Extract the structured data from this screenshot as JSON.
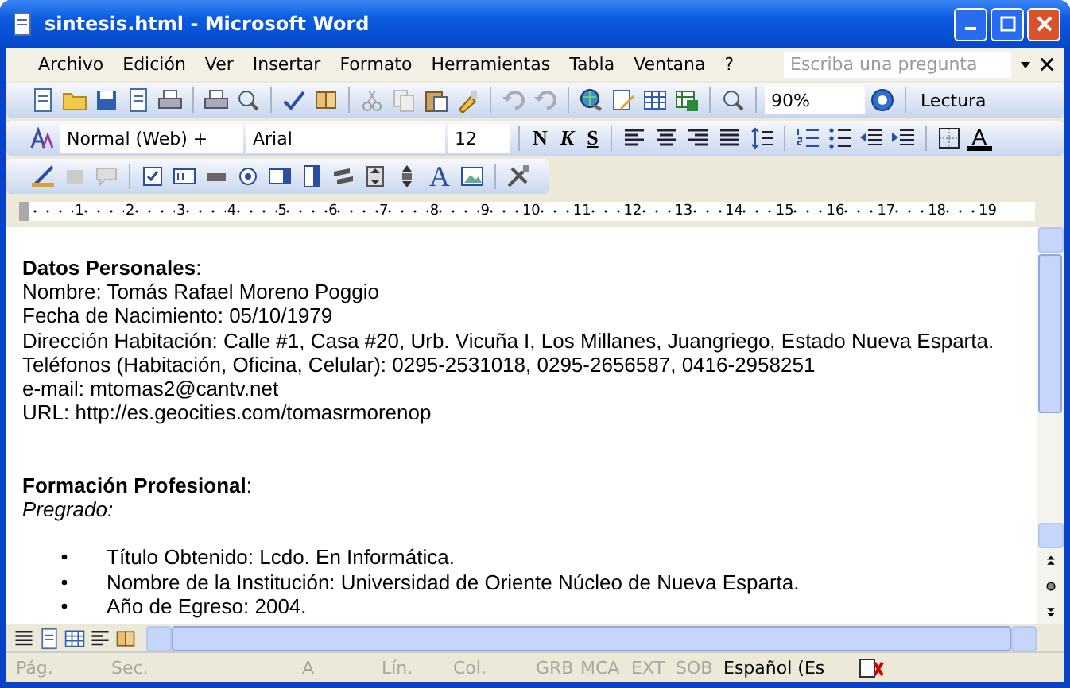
{
  "window": {
    "title": "sintesis.html - Microsoft Word"
  },
  "menu": {
    "items": [
      "Archivo",
      "Edición",
      "Ver",
      "Insertar",
      "Formato",
      "Herramientas",
      "Tabla",
      "Ventana",
      "?"
    ],
    "help_box": {
      "placeholder": "Escriba una pregunta"
    }
  },
  "standard_toolbar": {
    "zoom": "90%",
    "reading_button": "Lectura"
  },
  "format_toolbar": {
    "style": "Normal (Web) +",
    "font": "Arial",
    "size": "12",
    "bold": "N",
    "italic": "K",
    "underline": "S",
    "font_color": "A"
  },
  "forms_toolbar": {
    "wordart": "A"
  },
  "ruler": [
    "1",
    "2",
    "3",
    "4",
    "5",
    "6",
    "7",
    "8",
    "9",
    "10",
    "11",
    "12",
    "13",
    "14",
    "15",
    "16",
    "17",
    "18",
    "19"
  ],
  "document": [
    {
      "kind": "line",
      "text": "**Datos Personales**:"
    },
    {
      "kind": "line",
      "text": "Nombre: Tomás Rafael Moreno Poggio"
    },
    {
      "kind": "line",
      "text": "Fecha de Nacimiento: 05/10/1979"
    },
    {
      "kind": "line",
      "text": "Dirección Habitación: Calle #1, Casa #20, Urb. Vicuña I, Los Millanes, Juangriego, Estado Nueva Esparta."
    },
    {
      "kind": "line",
      "text": "Teléfonos (Habitación, Oficina, Celular): 0295-2531018, 0295-2656587, 0416-2958251"
    },
    {
      "kind": "line",
      "text": "e-mail: mtomas2@cantv.net"
    },
    {
      "kind": "line",
      "text": "URL: http://es.geocities.com/tomasrmorenop"
    },
    {
      "kind": "blank"
    },
    {
      "kind": "blank"
    },
    {
      "kind": "line",
      "text": "**Formación Profesional**:"
    },
    {
      "kind": "italic",
      "text": "Pregrado:"
    },
    {
      "kind": "blank"
    },
    {
      "kind": "bullet",
      "text": "Título Obtenido: Lcdo. En Informática."
    },
    {
      "kind": "bullet",
      "text": "Nombre de la Institución: Universidad de Oriente Núcleo de Nueva Esparta."
    },
    {
      "kind": "bullet",
      "text": "Año de Egreso: 2004."
    }
  ],
  "status_bar": [
    {
      "label": "Pág.",
      "disabled": true
    },
    {
      "label": "Sec.",
      "disabled": true
    },
    {
      "label": "A",
      "disabled": true
    },
    {
      "label": "Lín.",
      "disabled": true
    },
    {
      "label": "Col.",
      "disabled": true
    },
    {
      "label": "GRB",
      "disabled": true
    },
    {
      "label": "MCA",
      "disabled": true
    },
    {
      "label": "EXT",
      "disabled": true
    },
    {
      "label": "SOB",
      "disabled": true
    },
    {
      "label": "Español (Es",
      "disabled": false
    }
  ]
}
